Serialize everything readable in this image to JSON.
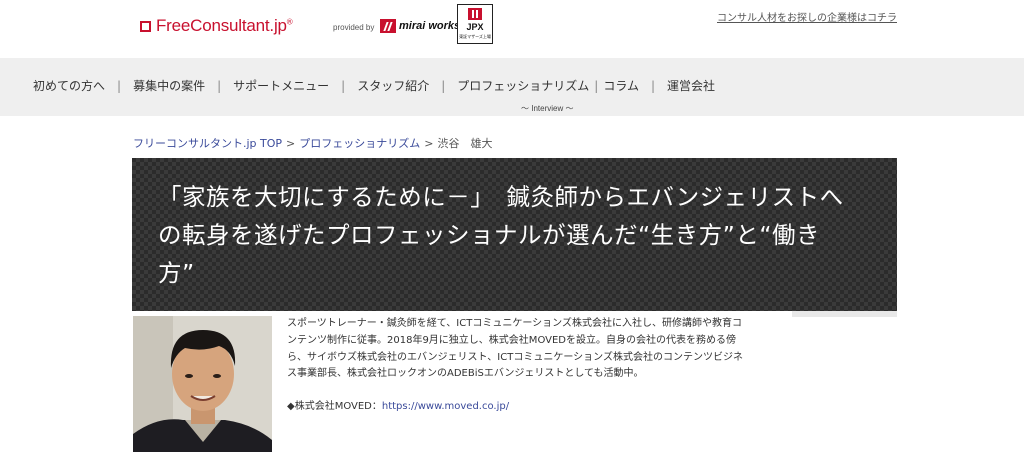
{
  "header": {
    "logo_text": "FreeConsultant.jp",
    "logo_mark": "®",
    "provided_by": "provided by",
    "partner": "mirai works",
    "jpx_label": "JPX",
    "jpx_sub": "東証マザーズ上場",
    "corporate_link": "コンサル人材をお探しの企業様はコチラ"
  },
  "nav": {
    "items": [
      "初めての方へ",
      "募集中の案件",
      "サポートメニュー",
      "スタッフ紹介",
      "プロフェッショナリズム",
      "コラム",
      "運営会社"
    ],
    "sub_label": "～ Interview ～"
  },
  "breadcrumb": {
    "items": [
      "フリーコンサルタント.jp TOP",
      "プロフェッショナリズム"
    ],
    "separator": ">",
    "current": "渋谷　雄大"
  },
  "hero": {
    "title": "「家族を大切にするために－」　鍼灸師からエバンジェリストへの転身を遂げたプロフェッショナルが選んだ“生き方”と“働き方”"
  },
  "profile": {
    "bio": "スポーツトレーナー・鍼灸師を経て、ICTコミュニケーションズ株式会社に入社し、研修講師や教育コンテンツ制作に従事。2018年9月に独立し、株式会社MOVEDを設立。自身の会社の代表を務める傍ら、サイボウズ株式会社のエバンジェリスト、ICTコミュニケーションズ株式会社のコンテンツビジネス事業部長、株式会社ロックオンのADEBiSエバンジェリストとしても活動中。",
    "company_label": "◆株式会社MOVED：",
    "company_url": "https://www.moved.co.jp/"
  },
  "colors": {
    "brand_red": "#c8102e",
    "nav_bg": "#efefef",
    "link_blue": "#3a4a9a",
    "hero_bg": "#2b2b2b"
  },
  "icons": [
    "freeconsultant-logo-icon",
    "mirai-works-logo-icon",
    "jpx-logo-icon"
  ]
}
